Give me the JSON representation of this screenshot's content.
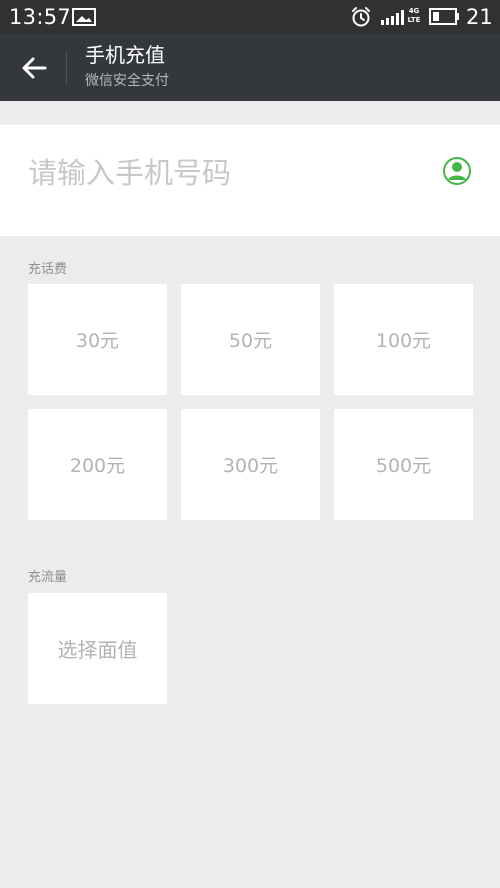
{
  "status_bar": {
    "time": "13:57",
    "network_badge": [
      "4G",
      "LTE"
    ],
    "battery": "21",
    "icons": {
      "gallery": "gallery-icon",
      "alarm": "alarm-icon",
      "signal": "signal-icon",
      "battery": "battery-icon"
    }
  },
  "header": {
    "title": "手机充值",
    "subtitle": "微信安全支付",
    "back_icon": "back-arrow-icon"
  },
  "phone_input": {
    "placeholder": "请输入手机号码",
    "contact_icon": "contact-icon"
  },
  "recharge": {
    "label": "充话费",
    "options": [
      "30元",
      "50元",
      "100元",
      "200元",
      "300元",
      "500元"
    ]
  },
  "data_plan": {
    "label": "充流量",
    "option": "选择面值"
  },
  "colors": {
    "status_bg": "#2f3133",
    "header_bg": "#34383c",
    "page_bg": "#ececec",
    "tile_bg": "#ffffff",
    "tile_text": "#b3b3b3",
    "accent_green": "#43b649"
  }
}
